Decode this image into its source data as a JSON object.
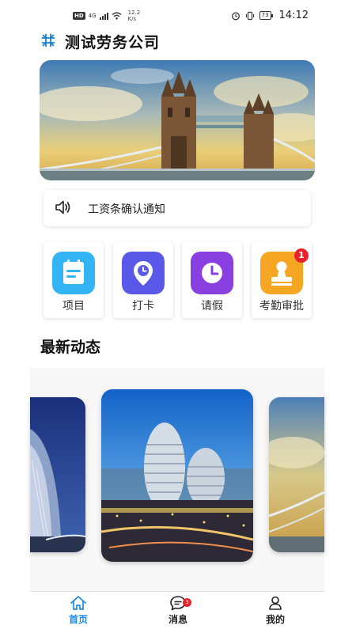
{
  "status_bar": {
    "network_badge": "HD",
    "network_type": "4G",
    "speed_value": "12.2",
    "speed_unit": "K/s",
    "battery": "73",
    "time": "14:12"
  },
  "header": {
    "company_name": "测试劳务公司",
    "logo_icon": "grid-hash-icon"
  },
  "banner": {
    "image": "tower-bridge-photo"
  },
  "notice": {
    "icon": "speaker-icon",
    "text": "工资条确认通知"
  },
  "features": [
    {
      "label": "项目",
      "icon": "project-icon",
      "color": "#33b5f5"
    },
    {
      "label": "打卡",
      "icon": "clock-in-icon",
      "color": "#5a58e8"
    },
    {
      "label": "请假",
      "icon": "leave-icon",
      "color": "#8a3fe0"
    },
    {
      "label": "考勤审批",
      "icon": "approval-icon",
      "color": "#f5a623",
      "badge": "1"
    }
  ],
  "news_section": {
    "title": "最新动态",
    "images": [
      "burj-al-arab-photo",
      "galaxy-soho-photo",
      "tower-bridge-photo"
    ]
  },
  "bottom_nav": {
    "items": [
      {
        "label": "首页",
        "icon": "home-icon",
        "active": true
      },
      {
        "label": "消息",
        "icon": "message-icon",
        "badge": "3"
      },
      {
        "label": "我的",
        "icon": "user-icon"
      }
    ],
    "active_color": "#1e88e5"
  }
}
